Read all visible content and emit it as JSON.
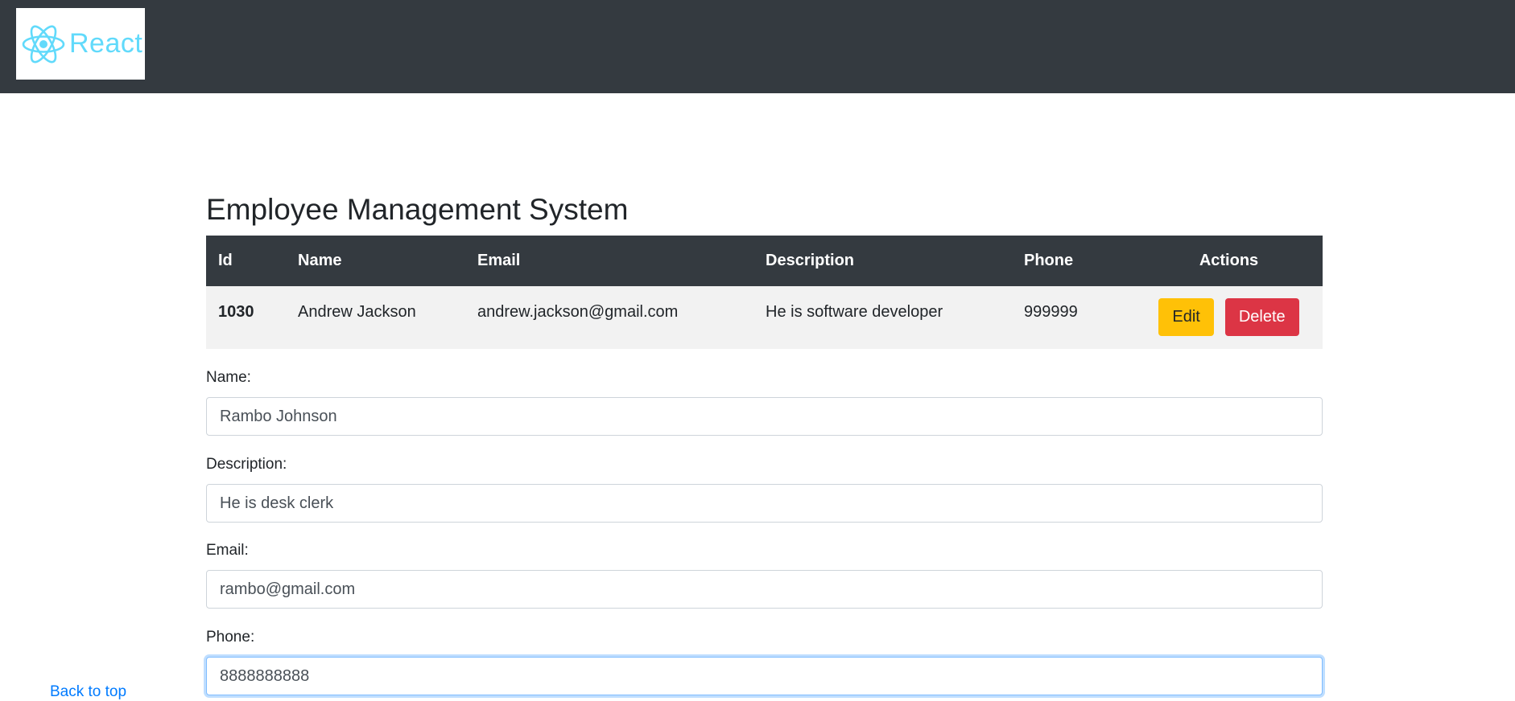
{
  "header": {
    "logo_text": "React",
    "logo_icon": "react-atom-icon",
    "logo_color": "#61dafb",
    "bg_color": "#343a40"
  },
  "page": {
    "title": "Employee Management System"
  },
  "table": {
    "columns": [
      "Id",
      "Name",
      "Email",
      "Description",
      "Phone",
      "Actions"
    ],
    "rows": [
      {
        "id": "1030",
        "name": "Andrew Jackson",
        "email": "andrew.jackson@gmail.com",
        "description": "He is software developer",
        "phone": "999999",
        "edit_label": "Edit",
        "delete_label": "Delete"
      }
    ]
  },
  "form": {
    "name_label": "Name:",
    "name_value": "Rambo Johnson",
    "description_label": "Description:",
    "description_value": "He is desk clerk",
    "email_label": "Email:",
    "email_value": "rambo@gmail.com",
    "phone_label": "Phone:",
    "phone_value": "8888888888"
  },
  "footer": {
    "back_to_top": "Back to top"
  },
  "colors": {
    "edit_button": "#ffc107",
    "delete_button": "#dc3545",
    "link": "#007bff"
  }
}
